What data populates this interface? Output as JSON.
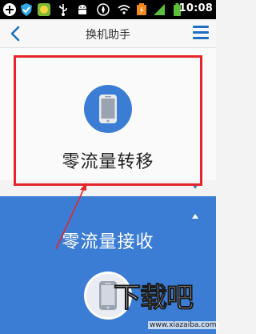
{
  "status_bar": {
    "time": "10:08",
    "icons": [
      "add-icon",
      "shield-icon",
      "game-icon",
      "usb-icon",
      "android-icon",
      "wifi-icon",
      "battery-charging-icon",
      "signal-icon",
      "battery-icon"
    ]
  },
  "header": {
    "title": "换机助手",
    "back_icon": "chevron-left-icon",
    "menu_icon": "hamburger-menu-icon"
  },
  "send_card": {
    "label": "零流量转移",
    "icon": "phone-icon",
    "toggle_icon": "triangle-down-icon"
  },
  "receive_panel": {
    "label": "零流量接收",
    "icon": "phone-icon",
    "toggle_icon": "triangle-up-icon"
  },
  "watermark": {
    "text": "下载吧",
    "sub": "www.xiazaiba.com"
  },
  "colors": {
    "accent_blue": "#1b6fc4",
    "panel_blue": "#3b7dd4",
    "highlight_red": "#e5242b"
  }
}
